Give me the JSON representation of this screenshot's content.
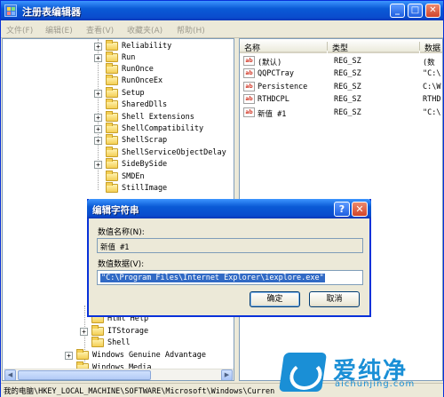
{
  "window": {
    "title": "注册表编辑器",
    "minimize": "_",
    "maximize": "□",
    "close": "✕"
  },
  "menu": [
    {
      "label": "文件(F)"
    },
    {
      "label": "编辑(E)"
    },
    {
      "label": "查看(V)"
    },
    {
      "label": "收藏夹(A)"
    },
    {
      "label": "帮助(H)"
    }
  ],
  "tree": [
    {
      "label": "Reliability",
      "expander": "+"
    },
    {
      "label": "Run",
      "expander": "+"
    },
    {
      "label": "RunOnce",
      "expander": ""
    },
    {
      "label": "RunOnceEx",
      "expander": ""
    },
    {
      "label": "Setup",
      "expander": "+"
    },
    {
      "label": "SharedDlls",
      "expander": ""
    },
    {
      "label": "Shell Extensions",
      "expander": "+"
    },
    {
      "label": "ShellCompatibility",
      "expander": "+"
    },
    {
      "label": "ShellScrap",
      "expander": "+"
    },
    {
      "label": "ShellServiceObjectDelay",
      "expander": ""
    },
    {
      "label": "SideBySide",
      "expander": "+"
    },
    {
      "label": "SMDEn",
      "expander": ""
    },
    {
      "label": "StillImage",
      "expander": ""
    }
  ],
  "tree_bottom": [
    {
      "label": "Html Help",
      "expander": ""
    },
    {
      "label": "ITStorage",
      "expander": "+"
    },
    {
      "label": "Shell",
      "expander": ""
    },
    {
      "label": "Windows Genuine Advantage",
      "expander": "+"
    },
    {
      "label": "Windows Media",
      "expander": ""
    }
  ],
  "list": {
    "columns": [
      "名称",
      "类型",
      "数据"
    ],
    "rows": [
      {
        "icon": "ab",
        "name": "(默认)",
        "type": "REG_SZ",
        "data": "(数"
      },
      {
        "icon": "ab",
        "name": "QQPCTray",
        "type": "REG_SZ",
        "data": "\"C:\\"
      },
      {
        "icon": "ab",
        "name": "Persistence",
        "type": "REG_SZ",
        "data": "C:\\W"
      },
      {
        "icon": "ab",
        "name": "RTHDCPL",
        "type": "REG_SZ",
        "data": "RTHD"
      },
      {
        "icon": "ab",
        "name": "新值 #1",
        "type": "REG_SZ",
        "data": "\"C:\\"
      }
    ]
  },
  "statusbar": "我的电脑\\HKEY_LOCAL_MACHINE\\SOFTWARE\\Microsoft\\Windows\\Curren",
  "dialog": {
    "title": "编辑字符串",
    "help": "?",
    "close": "✕",
    "name_label": "数值名称(N):",
    "name_value": "新值 #1",
    "data_label": "数值数据(V):",
    "data_value": "\"C:\\Program Files\\Internet Explorer\\iexplore.exe\"",
    "ok": "确定",
    "cancel": "取消"
  },
  "watermark": {
    "main": "爱纯净",
    "sub": "aichunjing.com"
  },
  "colors": {
    "titlebar": "#0a5ad6",
    "selection": "#316ac5",
    "brand": "#1a8fd6"
  }
}
